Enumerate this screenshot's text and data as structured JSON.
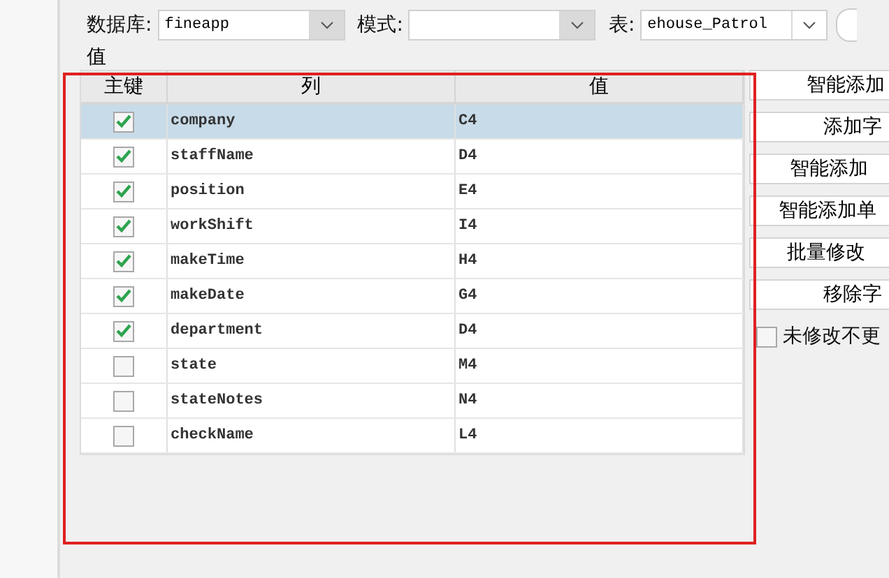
{
  "toolbar": {
    "database_label": "数据库:",
    "database": "fineapp",
    "schema_label": "模式:",
    "table_label": "表:",
    "table": "ehouse_Patrol"
  },
  "section_title": "值",
  "table": {
    "columns": [
      "主键",
      "列",
      "值"
    ],
    "rows": [
      {
        "key": true,
        "column": "company",
        "value": "C4",
        "selected": true
      },
      {
        "key": true,
        "column": "staffName",
        "value": "D4",
        "selected": false
      },
      {
        "key": true,
        "column": "position",
        "value": "E4",
        "selected": false
      },
      {
        "key": true,
        "column": "workShift",
        "value": "I4",
        "selected": false
      },
      {
        "key": true,
        "column": "makeTime",
        "value": "H4",
        "selected": false
      },
      {
        "key": true,
        "column": "makeDate",
        "value": "G4",
        "selected": false
      },
      {
        "key": true,
        "column": "department",
        "value": "D4",
        "selected": false
      },
      {
        "key": false,
        "column": "state",
        "value": "M4",
        "selected": false
      },
      {
        "key": false,
        "column": "stateNotes",
        "value": "N4",
        "selected": false
      },
      {
        "key": false,
        "column": "checkName",
        "value": "L4",
        "selected": false
      }
    ]
  },
  "buttons": [
    "智能添加",
    "添加字",
    "智能添加",
    "智能添加单",
    "批量修改",
    "移除字"
  ],
  "option": {
    "label": "未修改不更",
    "checked": false
  }
}
